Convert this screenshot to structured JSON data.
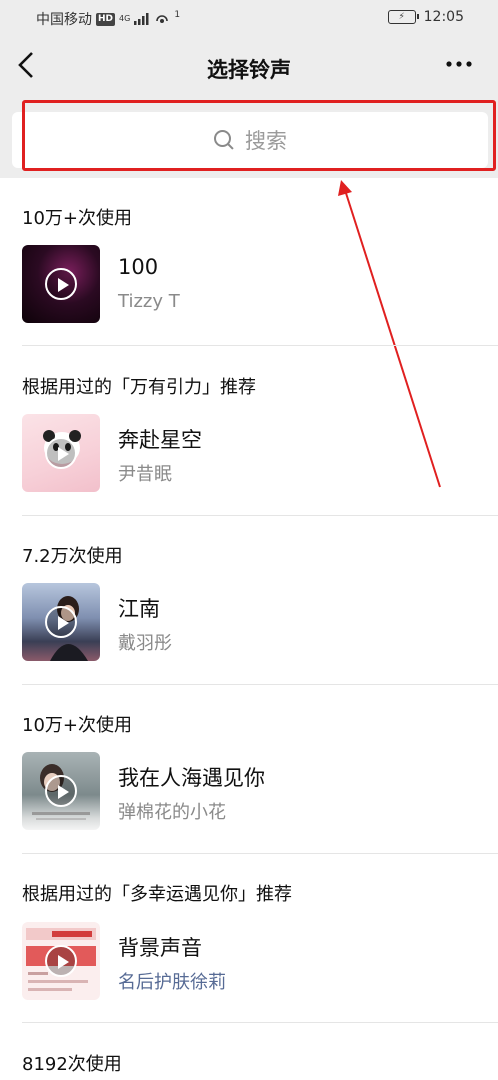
{
  "status_bar": {
    "carrier": "中国移动",
    "hd_badge": "HD",
    "network": "4G",
    "hotspot_count": "1",
    "time": "12:05"
  },
  "nav": {
    "title": "选择铃声"
  },
  "search": {
    "placeholder": "搜索"
  },
  "sections": [
    {
      "header": "10万+次使用",
      "title": "100",
      "subtitle": "Tizzy T",
      "subtitle_link": false
    },
    {
      "header": "根据用过的「万有引力」推荐",
      "title": "奔赴星空",
      "subtitle": "尹昔眠",
      "subtitle_link": false
    },
    {
      "header": "7.2万次使用",
      "title": "江南",
      "subtitle": "戴羽彤",
      "subtitle_link": false
    },
    {
      "header": "10万+次使用",
      "title": "我在人海遇见你",
      "subtitle": "弹棉花的小花",
      "subtitle_link": false
    },
    {
      "header": "根据用过的「多幸运遇见你」推荐",
      "title": "背景声音",
      "subtitle": "名后护肤徐莉",
      "subtitle_link": true
    },
    {
      "header": "8192次使用"
    }
  ],
  "colors": {
    "background_bar": "#ededed",
    "annotation_red": "#e02020",
    "link_blue": "#576b95"
  }
}
